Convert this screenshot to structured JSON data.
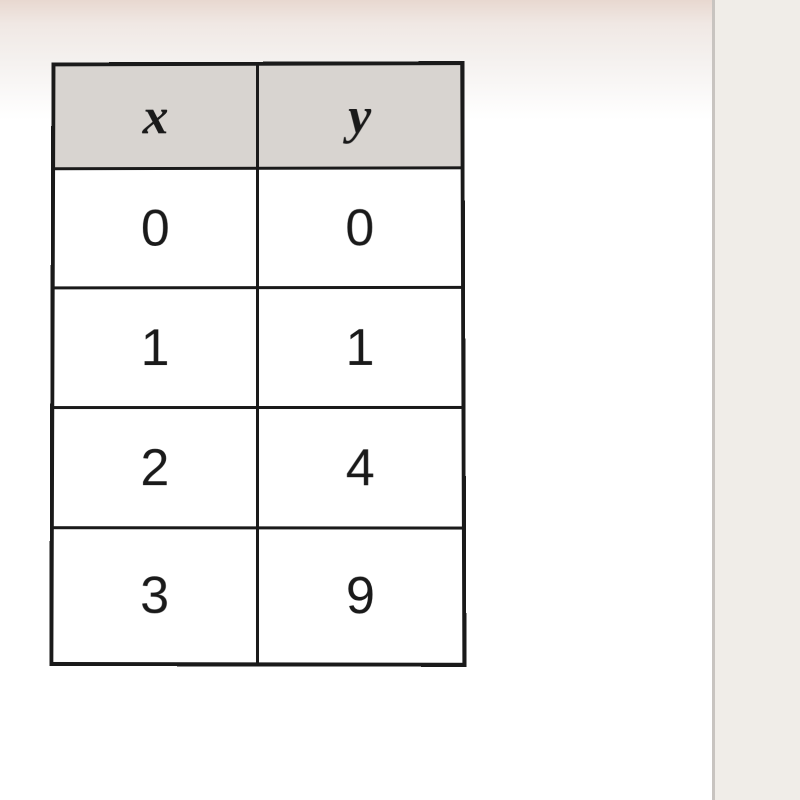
{
  "chart_data": {
    "type": "table",
    "headers": [
      "x",
      "y"
    ],
    "rows": [
      {
        "x": "0",
        "y": "0"
      },
      {
        "x": "1",
        "y": "1"
      },
      {
        "x": "2",
        "y": "4"
      },
      {
        "x": "3",
        "y": "9"
      }
    ]
  }
}
